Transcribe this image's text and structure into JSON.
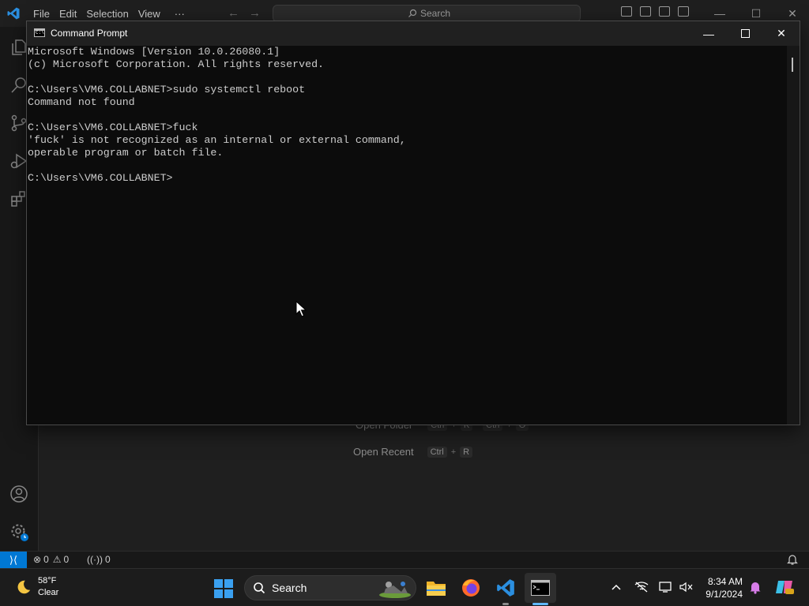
{
  "vscode": {
    "menu": [
      "File",
      "Edit",
      "Selection",
      "View",
      "···"
    ],
    "search_placeholder": "Search",
    "welcome": {
      "open_folder_label": "Open Folder",
      "open_folder_keys": [
        "Ctrl",
        "K",
        "Ctrl",
        "O"
      ],
      "open_recent_label": "Open Recent",
      "open_recent_keys": [
        "Ctrl",
        "R"
      ]
    },
    "statusbar": {
      "errors": "0",
      "warnings": "0",
      "ports": "0"
    }
  },
  "cmd": {
    "title": "Command Prompt",
    "lines": [
      "Microsoft Windows [Version 10.0.26080.1]",
      "(c) Microsoft Corporation. All rights reserved.",
      "",
      "C:\\Users\\VM6.COLLABNET>sudo systemctl reboot",
      "Command not found",
      "",
      "C:\\Users\\VM6.COLLABNET>fuck",
      "'fuck' is not recognized as an internal or external command,",
      "operable program or batch file.",
      "",
      "C:\\Users\\VM6.COLLABNET>"
    ]
  },
  "taskbar": {
    "weather_temp": "58°F",
    "weather_desc": "Clear",
    "search_label": "Search",
    "time": "8:34 AM",
    "date": "9/1/2024"
  },
  "colors": {
    "vscode_accent": "#0078d4",
    "console_bg": "#0c0c0c",
    "console_text": "#cccccc"
  }
}
